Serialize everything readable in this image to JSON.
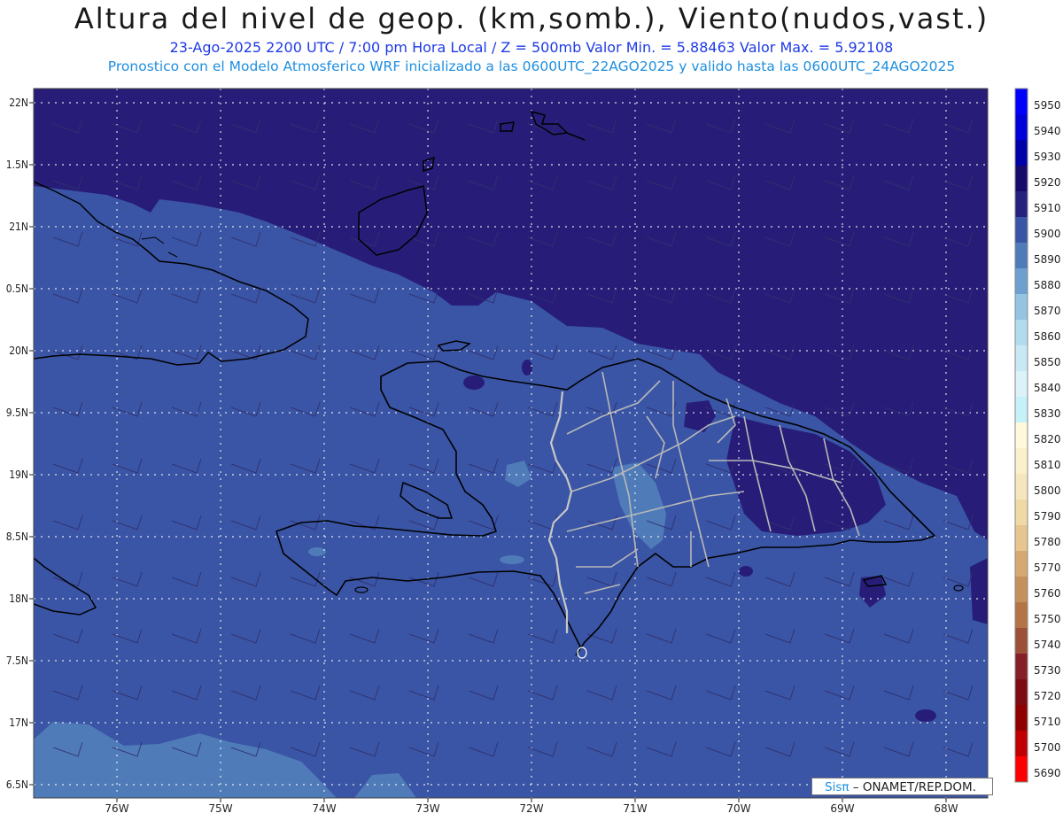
{
  "header": {
    "title": "Altura del nivel de geop. (km,somb.), Viento(nudos,vast.)",
    "line1": "23-Ago-2025  2200 UTC / 7:00 pm Hora Local / Z = 500mb     Valor Min. = 5.88463  Valor Max. = 5.92108",
    "line2": "Pronostico con el Modelo Atmosferico WRF inicializado a las 0600UTC_22AGO2025 y valido hasta las  0600UTC_24AGO2025"
  },
  "axes": {
    "lat_labels": [
      "22N",
      "1.5N",
      "21N",
      "0.5N",
      "20N",
      "9.5N",
      "19N",
      "8.5N",
      "18N",
      "7.5N",
      "17N",
      "6.5N"
    ],
    "lon_labels": [
      "76W",
      "75W",
      "74W",
      "73W",
      "72W",
      "71W",
      "70W",
      "69W",
      "68W"
    ]
  },
  "colorbar": {
    "labels": [
      "5950",
      "5940",
      "5930",
      "5920",
      "5910",
      "5900",
      "5890",
      "5880",
      "5870",
      "5860",
      "5850",
      "5840",
      "5830",
      "5820",
      "5810",
      "5800",
      "5790",
      "5780",
      "5770",
      "5760",
      "5750",
      "5740",
      "5730",
      "5720",
      "5710",
      "5700",
      "5690"
    ],
    "colors": [
      "#0000ff",
      "#0000d8",
      "#0000a8",
      "#160a6b",
      "#25217e",
      "#3a55a5",
      "#4f7cb8",
      "#6d9fcf",
      "#94c4e2",
      "#b2dcee",
      "#c8e9f4",
      "#dbf2f8",
      "#c6f1f9",
      "#fff8da",
      "#fbf0cc",
      "#f6e6bd",
      "#efd9a5",
      "#e6c58e",
      "#d6a970",
      "#c5915a",
      "#b37446",
      "#9c5038",
      "#861e27",
      "#7c0c12",
      "#8f0000",
      "#c00000",
      "#ff0000"
    ]
  },
  "legend": {
    "credit_brand": "Sisπ",
    "credit_text": "– ONAMET/REP.DOM."
  },
  "colors": {
    "deep": "#271d78",
    "mid": "#3a55a5",
    "light": "#4f7cb8",
    "coast": "#000000",
    "borders": "#bdbdbd"
  }
}
